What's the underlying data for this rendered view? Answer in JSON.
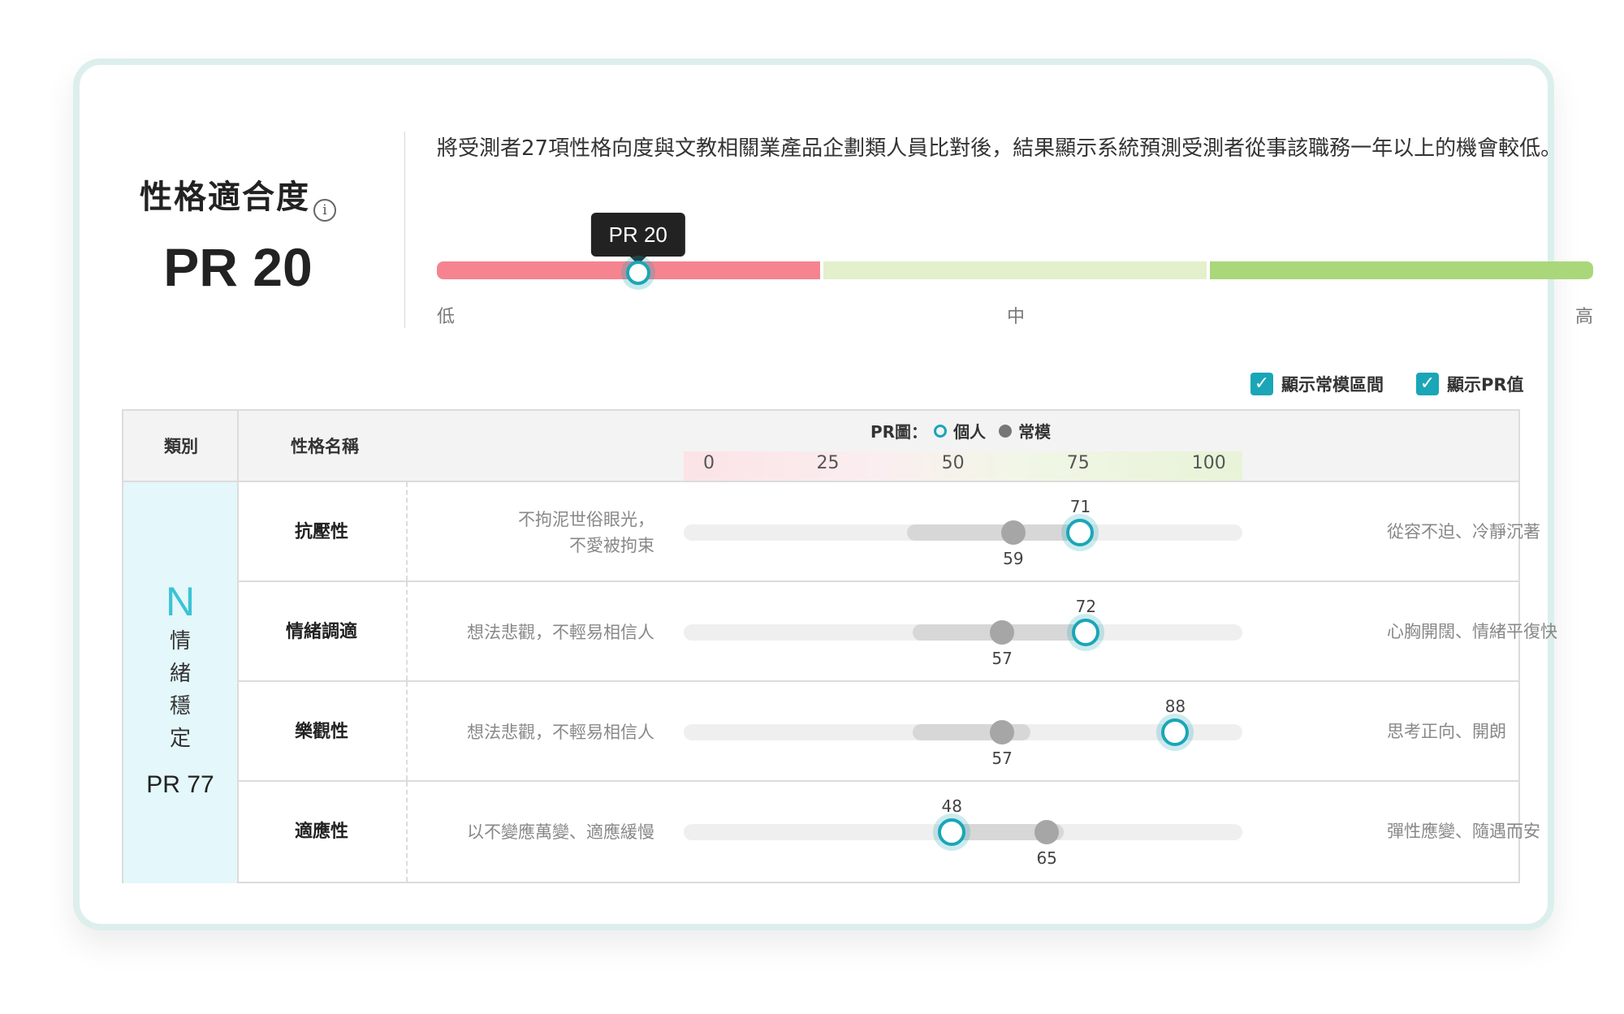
{
  "summary": {
    "title": "性格適合度",
    "pr_label": "PR 20",
    "pr_value": 20,
    "description": "將受測者27項性格向度與文教相關業產品企劃類人員比對後，結果顯示系統預測受測者從事該職務一年以上的機會較低。",
    "tooltip": "PR 20",
    "scale_labels": {
      "low": "低",
      "mid": "中",
      "high": "高"
    },
    "colors": {
      "low": "#f58490",
      "mid": "#e3f0cb",
      "high": "#a9d77a",
      "accent": "#1aa6b7"
    }
  },
  "options": {
    "show_norm_range": {
      "label": "顯示常模區間",
      "checked": true
    },
    "show_pr": {
      "label": "顯示PR值",
      "checked": true
    }
  },
  "table": {
    "headers": {
      "category": "類別",
      "trait_name": "性格名稱"
    },
    "legend": {
      "prefix": "PR圖：",
      "individual": "個人",
      "norm": "常模"
    },
    "axis_ticks": [
      "0",
      "25",
      "50",
      "75",
      "100"
    ],
    "category": {
      "letter": "N",
      "chars": [
        "情",
        "緒",
        "穩",
        "定"
      ],
      "pr": "PR 77"
    },
    "rows": [
      {
        "name": "抗壓性",
        "low_desc": "不拘泥世俗眼光，\n不愛被拘束",
        "high_desc": "從容不迫、冷靜沉著",
        "individual": 71,
        "norm": 59,
        "norm_range": [
          40,
          72
        ]
      },
      {
        "name": "情緒調適",
        "low_desc": "想法悲觀，不輕易相信人",
        "high_desc": "心胸開闊、情緒平復快",
        "individual": 72,
        "norm": 57,
        "norm_range": [
          41,
          72
        ]
      },
      {
        "name": "樂觀性",
        "low_desc": "想法悲觀，不輕易相信人",
        "high_desc": "思考正向、開朗",
        "individual": 88,
        "norm": 57,
        "norm_range": [
          41,
          62
        ]
      },
      {
        "name": "適應性",
        "low_desc": "以不變應萬變、適應緩慢",
        "high_desc": "彈性應變、隨遇而安",
        "individual": 48,
        "norm": 65,
        "norm_range": [
          46,
          68
        ]
      }
    ]
  }
}
